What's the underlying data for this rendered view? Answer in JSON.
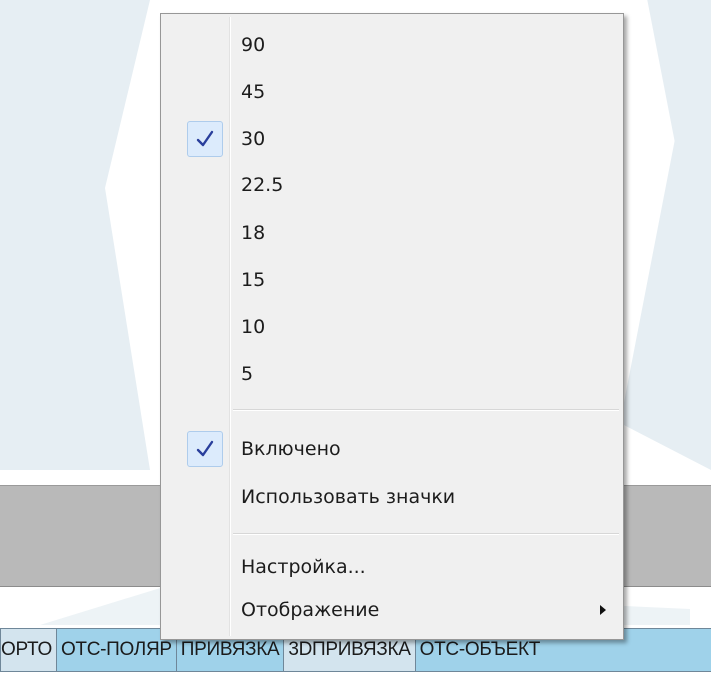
{
  "menu": {
    "angles": [
      "90",
      "45",
      "30",
      "22.5",
      "18",
      "15",
      "10",
      "5"
    ],
    "checked_angle": "30",
    "enabled_label": "Включено",
    "use_icons_label": "Использовать значки",
    "settings_label": "Настройка...",
    "display_label": "Отображение"
  },
  "statusbar": {
    "buttons": [
      {
        "label": "ОРТО",
        "state": "off"
      },
      {
        "label": "ОТС-ПОЛЯР",
        "state": "on"
      },
      {
        "label": "ПРИВЯЗКА",
        "state": "on"
      },
      {
        "label": "3DПРИВЯЗКА",
        "state": "off"
      },
      {
        "label": "ОТС-ОБЪЕКТ",
        "state": "on"
      }
    ]
  },
  "colors": {
    "check": "#2a3f9c",
    "status_on": "#9fd2ea",
    "status_off": "#d3e4ee"
  },
  "icons": {
    "check": "checkmark-icon",
    "submenu": "submenu-arrow-icon"
  }
}
